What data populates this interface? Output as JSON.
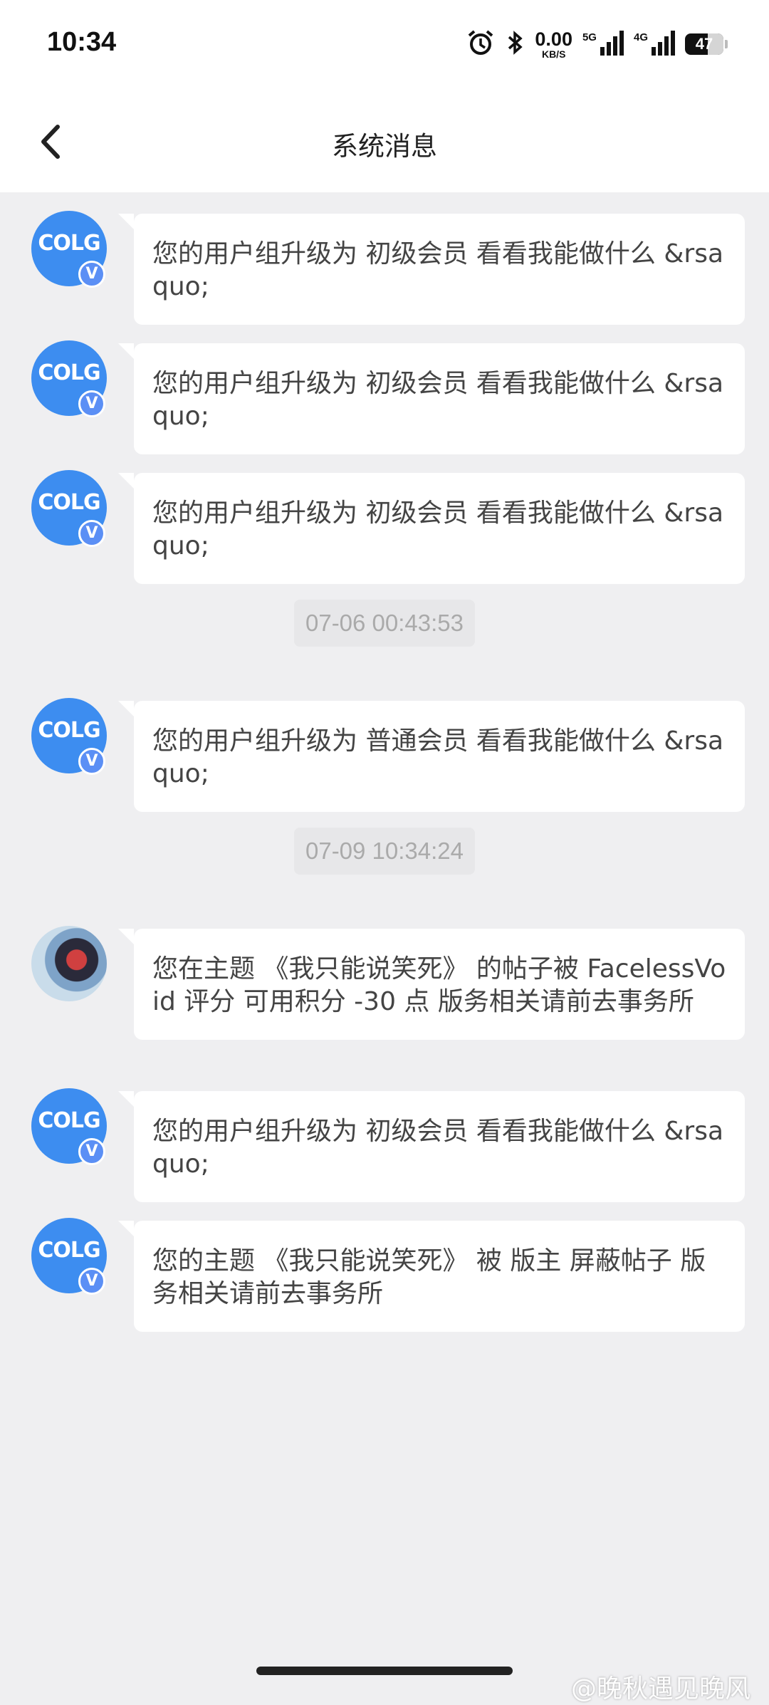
{
  "status": {
    "time": "10:34",
    "speed_value": "0.00",
    "speed_unit": "KB/S",
    "net1": "5G",
    "net2": "4G",
    "battery": "47"
  },
  "header": {
    "title": "系统消息"
  },
  "feed": [
    {
      "type": "message",
      "avatar": "colg",
      "text": "您的用户组升级为 初级会员  看看我能做什么 &rsaquo;"
    },
    {
      "type": "message",
      "avatar": "colg",
      "text": "您的用户组升级为 初级会员  看看我能做什么 &rsaquo;"
    },
    {
      "type": "message",
      "avatar": "colg",
      "text": "您的用户组升级为 初级会员  看看我能做什么 &rsaquo;"
    },
    {
      "type": "time",
      "text": "07-06 00:43:53"
    },
    {
      "type": "message",
      "avatar": "colg",
      "text": "您的用户组升级为 普通会员  看看我能做什么 &rsaquo;"
    },
    {
      "type": "time",
      "text": "07-09 10:34:24"
    },
    {
      "type": "message",
      "avatar": "photo",
      "text": "您在主题 《我只能说笑死》 的帖子被 FacelessVoid 评分 可用积分 -30 点 版务相关请前去事务所"
    },
    {
      "type": "message",
      "avatar": "colg",
      "text": "您的用户组升级为 初级会员  看看我能做什么 &rsaquo;"
    },
    {
      "type": "message",
      "avatar": "colg",
      "text": "您的主题 《我只能说笑死》 被 版主 屏蔽帖子  版务相关请前去事务所"
    }
  ],
  "avatar_logo": "COLG",
  "avatar_badge": "V",
  "watermark": "@晚秋遇见晚风",
  "colors": {
    "accent": "#3d8df0",
    "background": "#efeff1"
  }
}
